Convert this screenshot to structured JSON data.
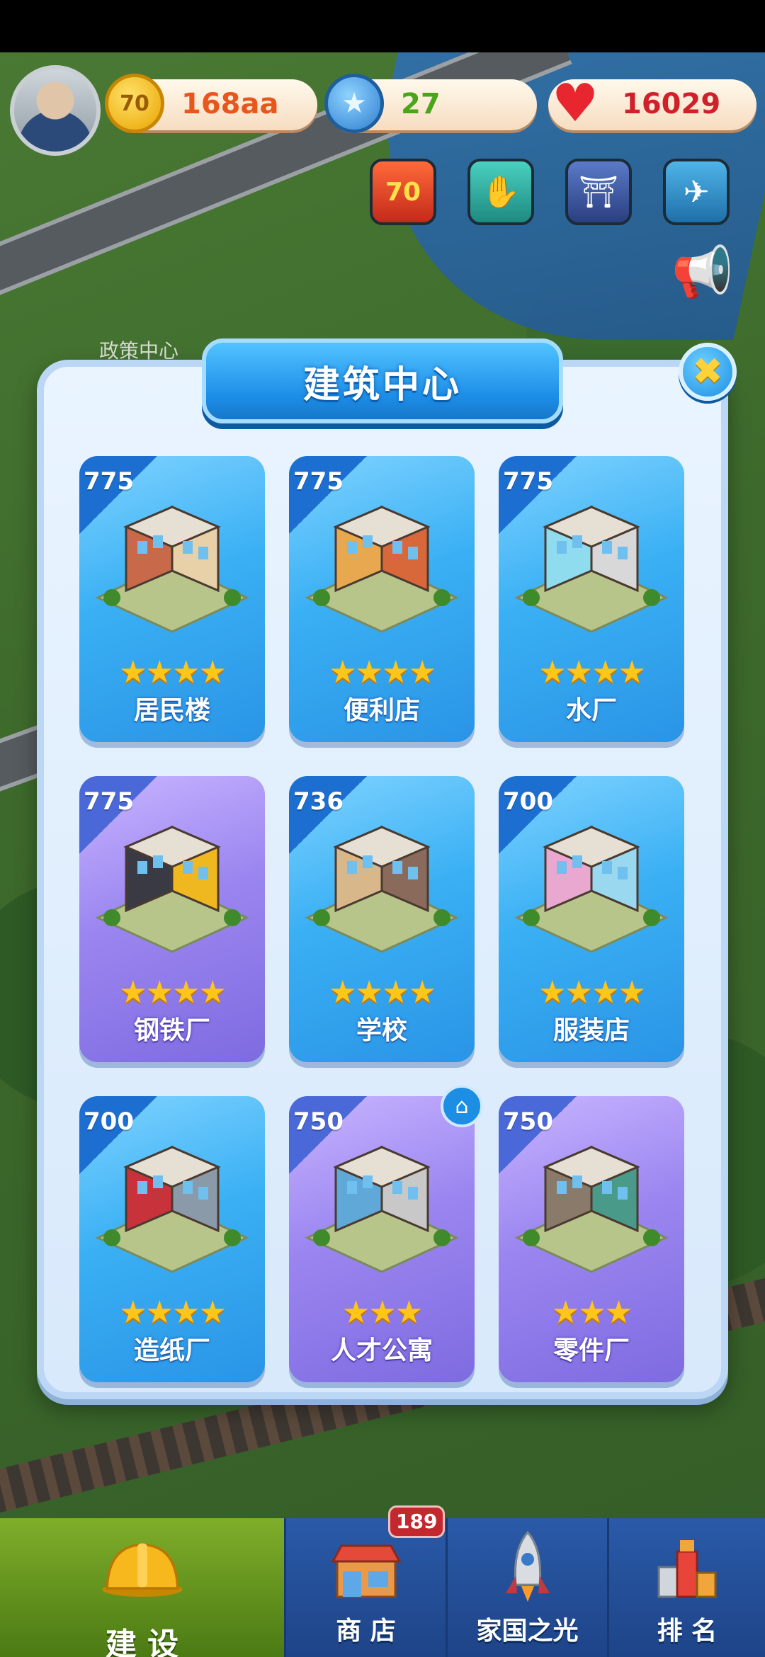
{
  "hud": {
    "coins": "168aa",
    "coin_icon_text": "70",
    "stars": "27",
    "hearts": "16029",
    "quick_buttons": [
      "70-anniversary-icon",
      "handshake-icon",
      "bridge-icon",
      "airplane-icon"
    ]
  },
  "map": {
    "label": "政策中心"
  },
  "modal": {
    "title": "建筑中心",
    "close_icon": "✖",
    "cards": [
      {
        "score": "775",
        "name": "居民楼",
        "stars": "★★★★",
        "theme": "blue"
      },
      {
        "score": "775",
        "name": "便利店",
        "stars": "★★★★",
        "theme": "blue"
      },
      {
        "score": "775",
        "name": "水厂",
        "stars": "★★★★",
        "theme": "blue"
      },
      {
        "score": "775",
        "name": "钢铁厂",
        "stars": "★★★★",
        "theme": "purple"
      },
      {
        "score": "736",
        "name": "学校",
        "stars": "★★★★",
        "theme": "blue"
      },
      {
        "score": "700",
        "name": "服装店",
        "stars": "★★★★",
        "theme": "blue"
      },
      {
        "score": "700",
        "name": "造纸厂",
        "stars": "★★★★",
        "theme": "blue"
      },
      {
        "score": "750",
        "name": "人才公寓",
        "stars": "★★★",
        "theme": "purple"
      },
      {
        "score": "750",
        "name": "零件厂",
        "stars": "★★★",
        "theme": "purple"
      }
    ]
  },
  "nav": {
    "items": [
      {
        "label": "建 设",
        "icon": "hardhat-icon"
      },
      {
        "label": "商 店",
        "icon": "shop-icon"
      },
      {
        "label": "家国之光",
        "icon": "rocket-icon"
      },
      {
        "label": "排 名",
        "icon": "ranking-icon"
      }
    ],
    "shop_badge": "189"
  }
}
